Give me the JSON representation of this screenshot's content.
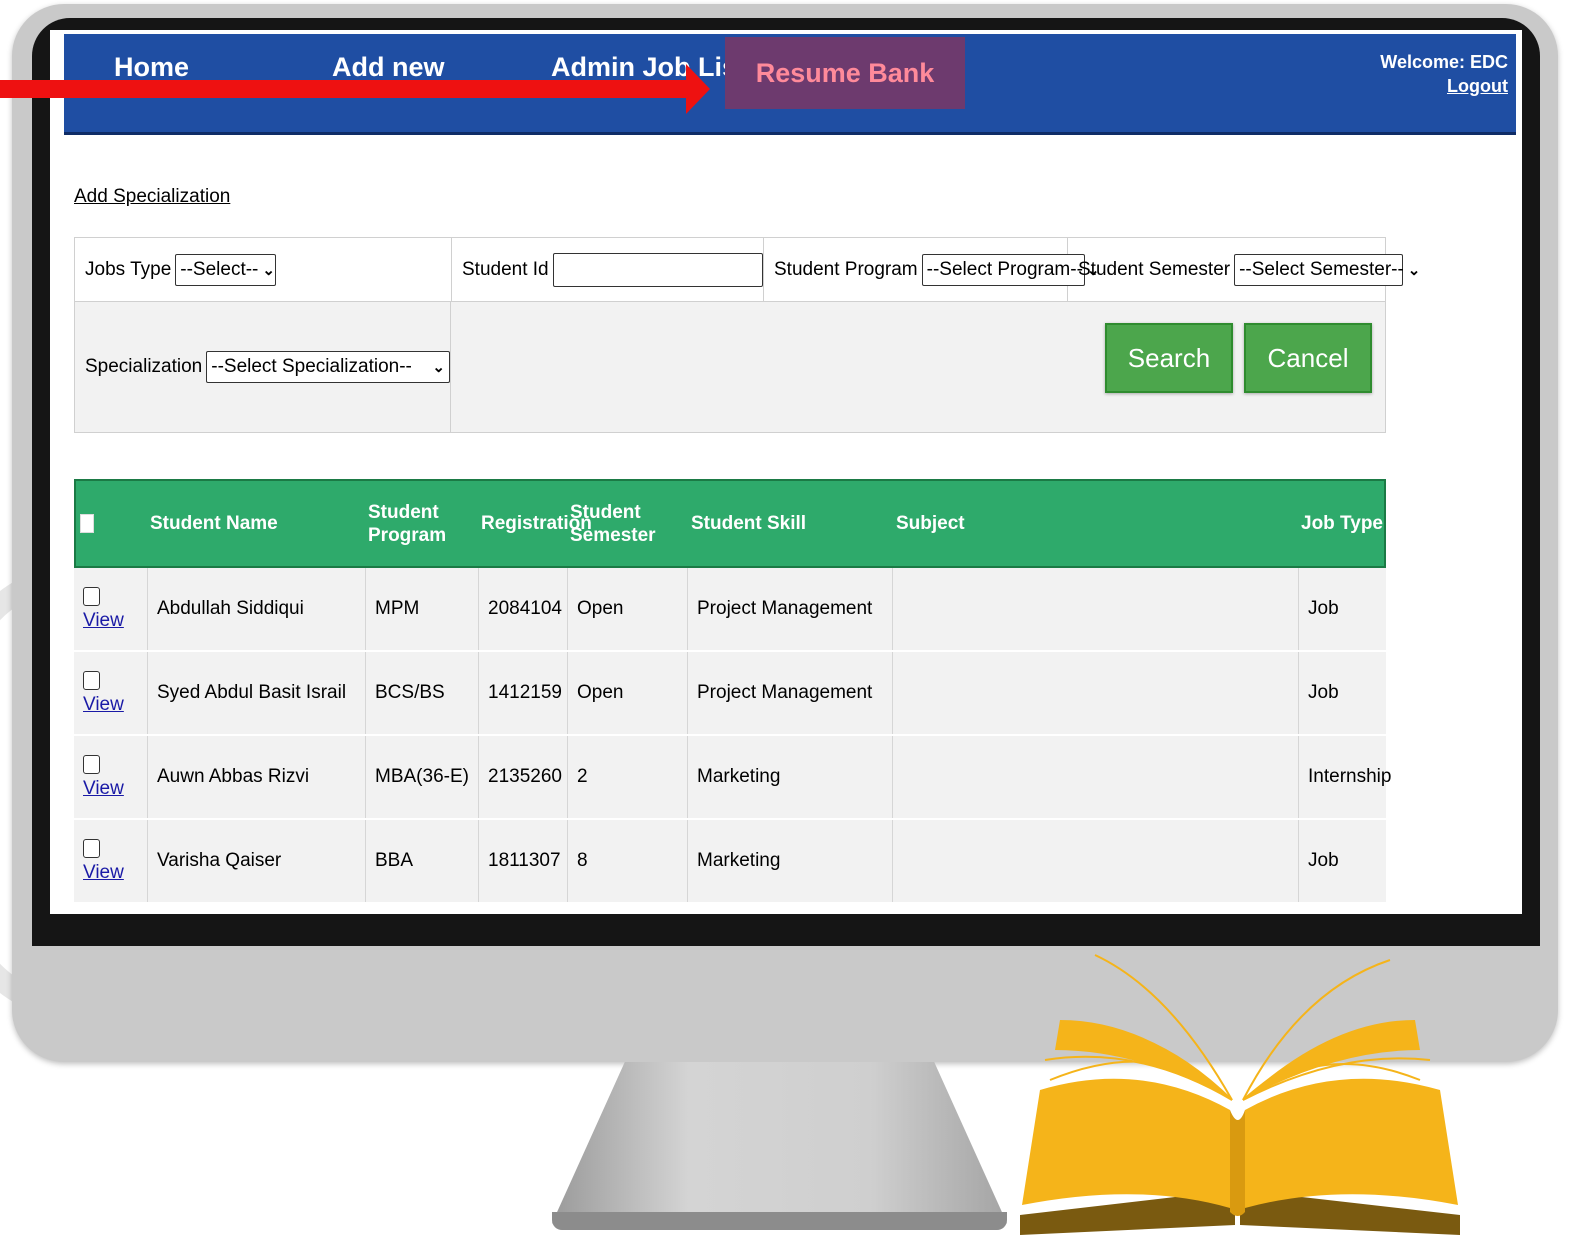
{
  "nav": {
    "home": "Home",
    "add_new": "Add new",
    "admin_job_list": "Admin Job List",
    "resume_bank": "Resume Bank",
    "welcome": "Welcome: EDC",
    "logout": "Logout"
  },
  "add_specialization": "Add Specialization",
  "filters": {
    "jobs_type_label": "Jobs Type",
    "jobs_type_value": "--Select--",
    "student_id_label": "Student Id",
    "student_id_value": "",
    "student_program_label": "Student Program",
    "student_program_value": "--Select Program--",
    "student_semester_label": "Student Semester",
    "student_semester_value": "--Select Semester--",
    "specialization_label": "Specialization",
    "specialization_value": "--Select Specialization--",
    "search_label": "Search",
    "cancel_label": "Cancel"
  },
  "table": {
    "headers": {
      "name": "Student Name",
      "program_1": "Student",
      "program_2": "Program",
      "registration": "Registration",
      "semester_1": "Student",
      "semester_2": "Semester",
      "skill": "Student Skill",
      "subject": "Subject",
      "job_type": "Job Type"
    },
    "view_label": "View",
    "rows": [
      {
        "name": "Abdullah Siddiqui",
        "program": "MPM",
        "registration": "2084104",
        "semester": "Open",
        "skill": "Project Management",
        "subject": "",
        "job_type": "Job"
      },
      {
        "name": "Syed Abdul Basit Israil",
        "program": "BCS/BS",
        "registration": "1412159",
        "semester": "Open",
        "skill": "Project Management",
        "subject": "",
        "job_type": "Job"
      },
      {
        "name": "Auwn Abbas Rizvi",
        "program": "MBA(36-E)",
        "registration": "2135260",
        "semester": "2",
        "skill": "Marketing",
        "subject": "",
        "job_type": "Internship"
      },
      {
        "name": "Varisha Qaiser",
        "program": "BBA",
        "registration": "1811307",
        "semester": "8",
        "skill": "Marketing",
        "subject": "",
        "job_type": "Job"
      }
    ]
  },
  "colors": {
    "navbar": "#1f4ea3",
    "active_tab": "#6d3a6e",
    "active_tab_text": "#ff8a9a",
    "grid_header": "#2eaa6b",
    "button": "#4ca64c",
    "arrow": "#ee1111",
    "book": "#f5b41a"
  }
}
